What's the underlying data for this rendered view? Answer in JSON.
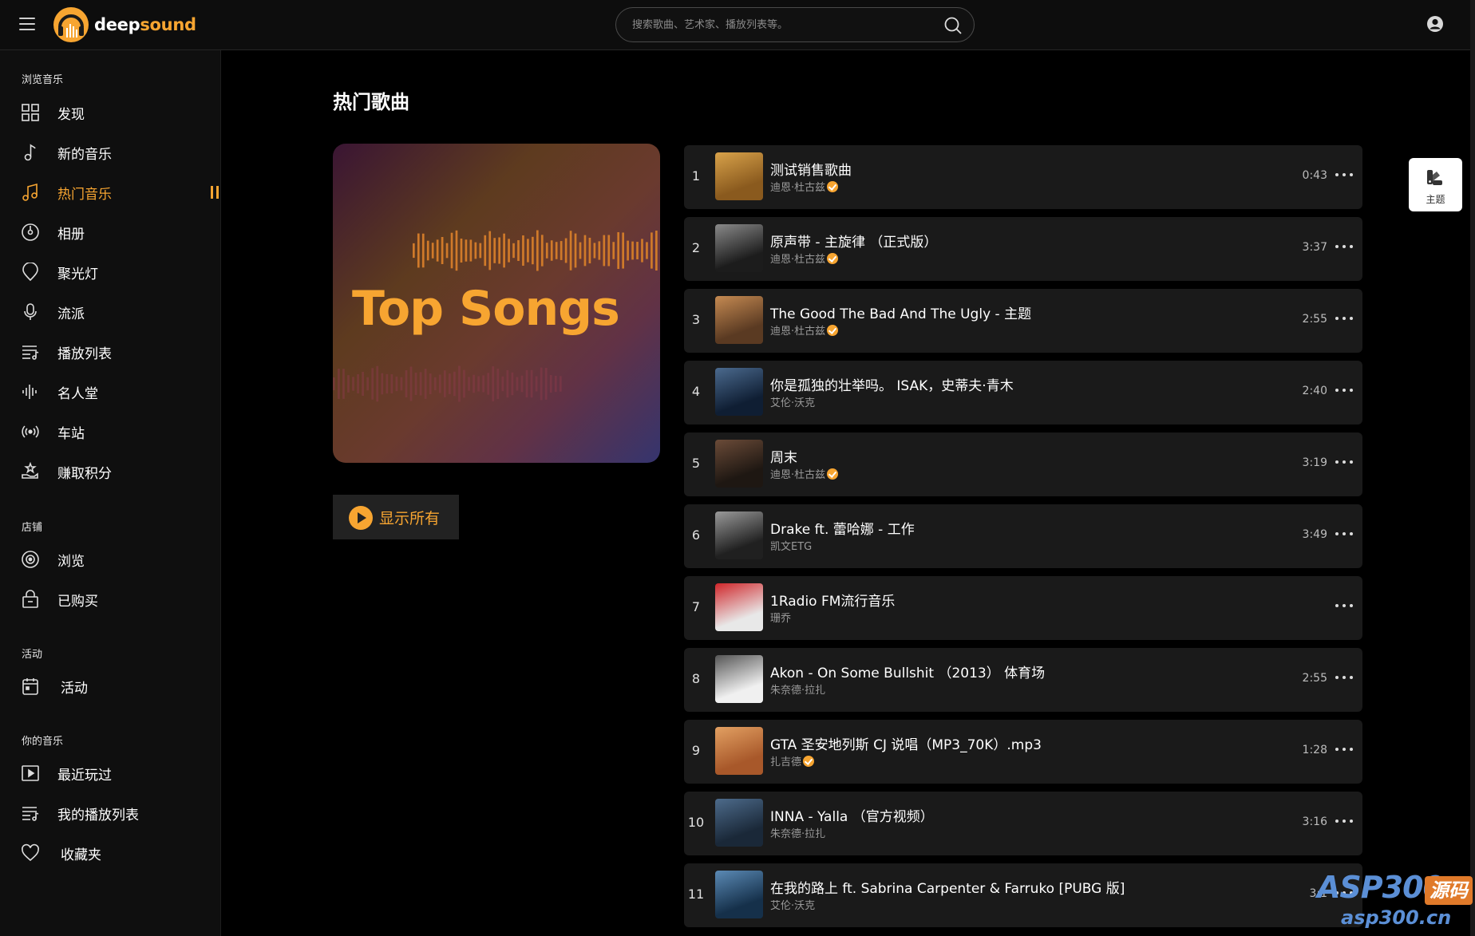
{
  "brand": {
    "name_part1": "deep",
    "name_part2": "sound",
    "accent_color": "#f7a531"
  },
  "search": {
    "placeholder": "搜索歌曲、艺术家、播放列表等。"
  },
  "sidebar": {
    "sections": [
      {
        "title": "浏览音乐",
        "items": [
          {
            "label": "发现",
            "icon": "grid-icon"
          },
          {
            "label": "新的音乐",
            "icon": "music-note-icon"
          },
          {
            "label": "热门音乐",
            "icon": "music-notes-icon",
            "active": true
          },
          {
            "label": "相册",
            "icon": "album-disc-icon"
          },
          {
            "label": "聚光灯",
            "icon": "spotlight-icon"
          },
          {
            "label": "流派",
            "icon": "microphone-icon"
          },
          {
            "label": "播放列表",
            "icon": "playlist-icon"
          },
          {
            "label": "名人堂",
            "icon": "waveform-icon"
          },
          {
            "label": "车站",
            "icon": "radio-waves-icon"
          },
          {
            "label": "赚取积分",
            "icon": "earn-points-icon"
          }
        ]
      },
      {
        "title": "店铺",
        "items": [
          {
            "label": "浏览",
            "icon": "browse-globe-icon"
          },
          {
            "label": "已购买",
            "icon": "purchased-bag-icon"
          }
        ]
      },
      {
        "title": "活动",
        "items": [
          {
            "label": "活动",
            "icon": "calendar-icon"
          }
        ]
      },
      {
        "title": "你的音乐",
        "items": [
          {
            "label": "最近玩过",
            "icon": "recent-play-icon"
          },
          {
            "label": "我的播放列表",
            "icon": "my-playlist-icon"
          },
          {
            "label": "收藏夹",
            "icon": "heart-icon"
          }
        ]
      }
    ]
  },
  "main": {
    "title": "热门歌曲",
    "cover_text": "Top Songs",
    "show_all_label": "显示所有"
  },
  "theme_button": {
    "label": "主题"
  },
  "songs": [
    {
      "num": "1",
      "title": "测试销售歌曲",
      "artist": "迪恩·杜古兹",
      "verified": true,
      "duration": "0:43"
    },
    {
      "num": "2",
      "title": "原声带 - 主旋律 （正式版）",
      "artist": "迪恩·杜古兹",
      "verified": true,
      "duration": "3:37"
    },
    {
      "num": "3",
      "title": "The Good The Bad And The Ugly - 主题",
      "artist": "迪恩·杜古兹",
      "verified": true,
      "duration": "2:55"
    },
    {
      "num": "4",
      "title": "你是孤独的壮举吗。 ISAK，史蒂夫·青木",
      "artist": "艾伦·沃克",
      "verified": false,
      "duration": "2:40"
    },
    {
      "num": "5",
      "title": "周末",
      "artist": "迪恩·杜古兹",
      "verified": true,
      "duration": "3:19"
    },
    {
      "num": "6",
      "title": "Drake ft. 蕾哈娜 - 工作",
      "artist": "凯文ETG",
      "verified": false,
      "duration": "3:49"
    },
    {
      "num": "7",
      "title": "1Radio FM流行音乐",
      "artist": "珊乔",
      "verified": false,
      "duration": ""
    },
    {
      "num": "8",
      "title": "Akon - On Some Bullshit （2013） 体育场",
      "artist": "朱奈德·拉扎",
      "verified": false,
      "duration": "2:55"
    },
    {
      "num": "9",
      "title": "GTA 圣安地列斯 CJ 说唱（MP3_70K）.mp3",
      "artist": "扎吉德",
      "verified": true,
      "duration": "1:28"
    },
    {
      "num": "10",
      "title": "INNA - Yalla （官方视频）",
      "artist": "朱奈德·拉扎",
      "verified": false,
      "duration": "3:16"
    },
    {
      "num": "11",
      "title": "在我的路上 ft. Sabrina Carpenter & Farruko [PUBG 版]",
      "artist": "艾伦·沃克",
      "verified": false,
      "duration": "3:1"
    }
  ],
  "watermark": {
    "text1": "ASP300",
    "text2": "源码",
    "text3": "asp300.cn"
  }
}
